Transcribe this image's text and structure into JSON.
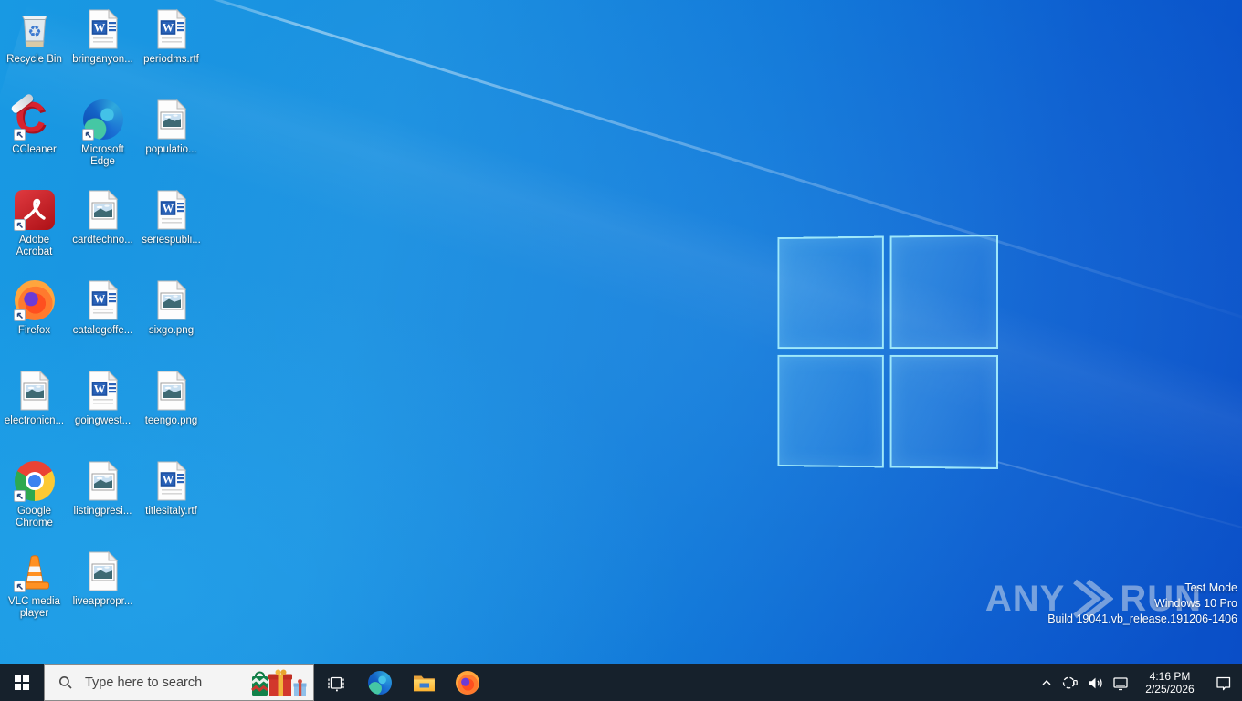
{
  "desktop": {
    "icons": [
      {
        "label": "Recycle Bin",
        "kind": "recycle-bin",
        "col": 1,
        "row": 1,
        "shortcut": false
      },
      {
        "label": "bringanyon...",
        "kind": "word-doc",
        "col": 2,
        "row": 1,
        "shortcut": false
      },
      {
        "label": "periodms.rtf",
        "kind": "word-doc",
        "col": 3,
        "row": 1,
        "shortcut": false
      },
      {
        "label": "CCleaner",
        "kind": "ccleaner",
        "col": 1,
        "row": 2,
        "shortcut": true
      },
      {
        "label": "Microsoft Edge",
        "kind": "microsoft-edge",
        "col": 2,
        "row": 2,
        "shortcut": true
      },
      {
        "label": "populatio...",
        "kind": "image-file",
        "col": 3,
        "row": 2,
        "shortcut": false
      },
      {
        "label": "Adobe Acrobat",
        "kind": "adobe-acrobat",
        "col": 1,
        "row": 3,
        "shortcut": true
      },
      {
        "label": "cardtechno...",
        "kind": "image-file",
        "col": 2,
        "row": 3,
        "shortcut": false
      },
      {
        "label": "seriespubli...",
        "kind": "word-doc",
        "col": 3,
        "row": 3,
        "shortcut": false
      },
      {
        "label": "Firefox",
        "kind": "firefox",
        "col": 1,
        "row": 4,
        "shortcut": true
      },
      {
        "label": "catalogoffe...",
        "kind": "word-doc",
        "col": 2,
        "row": 4,
        "shortcut": false
      },
      {
        "label": "sixgo.png",
        "kind": "image-file",
        "col": 3,
        "row": 4,
        "shortcut": false
      },
      {
        "label": "electronicn...",
        "kind": "image-file",
        "col": 1,
        "row": 5,
        "shortcut": false
      },
      {
        "label": "goingwest...",
        "kind": "word-doc",
        "col": 2,
        "row": 5,
        "shortcut": false
      },
      {
        "label": "teengo.png",
        "kind": "image-file",
        "col": 3,
        "row": 5,
        "shortcut": false
      },
      {
        "label": "Google Chrome",
        "kind": "google-chrome",
        "col": 1,
        "row": 6,
        "shortcut": true
      },
      {
        "label": "listingpresi...",
        "kind": "image-file",
        "col": 2,
        "row": 6,
        "shortcut": false
      },
      {
        "label": "titlesitaly.rtf",
        "kind": "word-doc",
        "col": 3,
        "row": 6,
        "shortcut": false
      },
      {
        "label": "VLC media player",
        "kind": "vlc",
        "col": 1,
        "row": 7,
        "shortcut": true
      },
      {
        "label": "liveappropr...",
        "kind": "image-file",
        "col": 2,
        "row": 7,
        "shortcut": false
      }
    ]
  },
  "watermark": {
    "brand_left": "ANY",
    "brand_right": "RUN",
    "test_mode_lines": [
      "Test Mode",
      "Windows 10 Pro",
      "Build 19041.vb_release.191206-1406"
    ]
  },
  "taskbar": {
    "search": {
      "placeholder": "Type here to search"
    },
    "buttons": [
      "start",
      "task-view",
      "microsoft-edge",
      "file-explorer",
      "firefox"
    ],
    "tray": {
      "time": "4:16 PM",
      "date": "2/25/2026"
    }
  },
  "colors": {
    "taskbar_bg": "#16212c",
    "wallpaper_light": "#1899e3",
    "wallpaper_dark": "#0a4ec7",
    "logo_border": "#a8f0fc",
    "search_bg": "#f4f4f4"
  }
}
